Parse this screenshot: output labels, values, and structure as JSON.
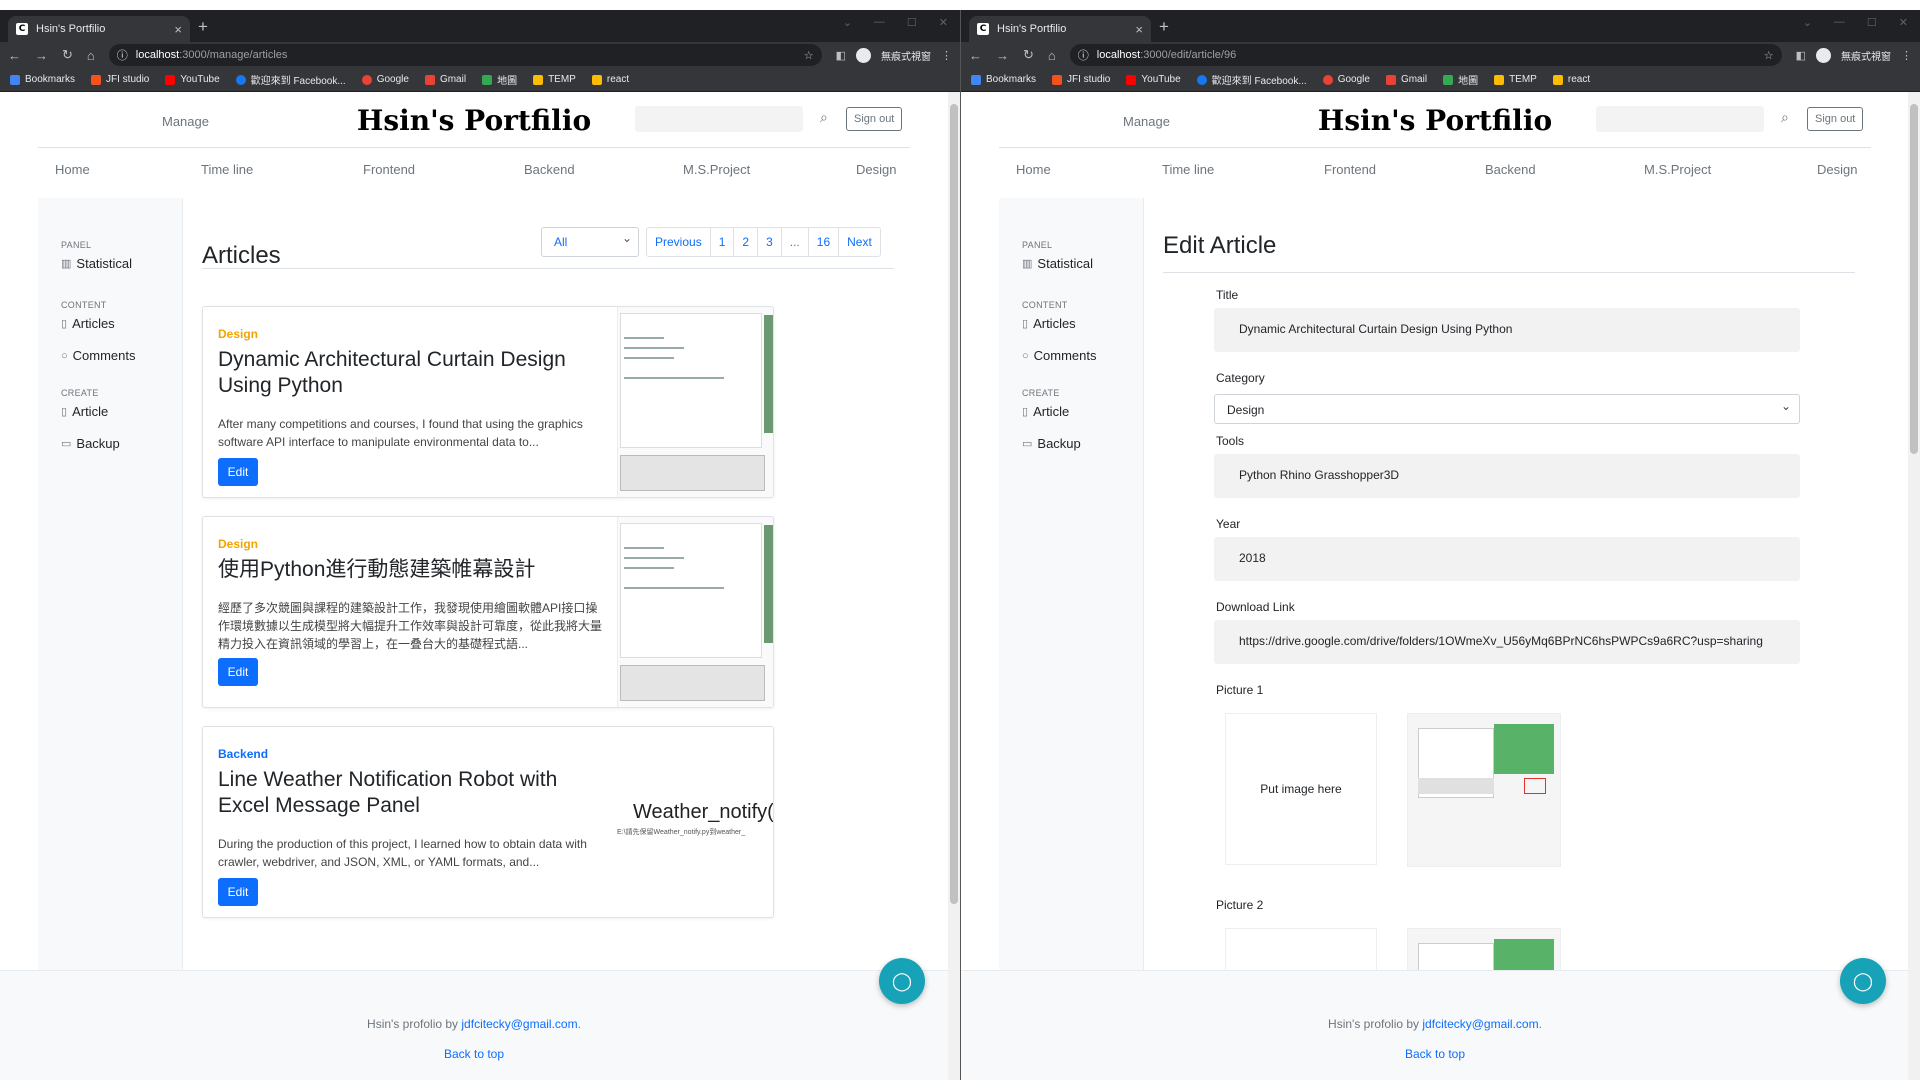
{
  "browser": {
    "tab_title": "Hsin's Portfilio",
    "tab_close": "×",
    "new_tab": "+",
    "profile_label": "無痕式視窗",
    "left_url_host": "localhost",
    "left_url_path": ":3000/manage/articles",
    "right_url_host": "localhost",
    "right_url_path": ":3000/edit/article/96",
    "bookmarks": [
      "Bookmarks",
      "JFI studio",
      "YouTube",
      "歡迎來到 Facebook...",
      "Google",
      "Gmail",
      "地圖",
      "TEMP",
      "react"
    ],
    "bookmark_colors": [
      "#4285f4",
      "#f4511e",
      "#ff0000",
      "#1877f2",
      "#ea4335",
      "#ea4335",
      "#34a853",
      "#fbbc04",
      "#fbbc04"
    ]
  },
  "site": {
    "manage": "Manage",
    "brand": "Hsin's Portfilio",
    "sign_out": "Sign out",
    "nav": [
      "Home",
      "Time line",
      "Frontend",
      "Backend",
      "M.S.Project",
      "Design"
    ]
  },
  "sidebar": {
    "panel_head": "PANEL",
    "statistical": "Statistical",
    "content_head": "CONTENT",
    "articles": "Articles",
    "comments": "Comments",
    "create_head": "CREATE",
    "article": "Article",
    "backup": "Backup"
  },
  "articles_page": {
    "title": "Articles",
    "filter": "All",
    "pager": [
      "Previous",
      "1",
      "2",
      "3",
      "...",
      "16",
      "Next"
    ],
    "edit_label": "Edit",
    "cards": [
      {
        "category": "Design",
        "category_color": "#f0a500",
        "title": "Dynamic Architectural Curtain Design Using Python",
        "desc": "After many competitions and courses, I found that using the graphics software API interface to manipulate environmental data to..."
      },
      {
        "category": "Design",
        "category_color": "#f0a500",
        "title": "使用Python進行動態建築帷幕設計",
        "desc": "經歷了多次競圖與課程的建築設計工作，我發現使用繪圖軟體API接口操作環境數據以生成模型將大幅提升工作效率與設計可靠度，從此我將大量精力投入在資訊領域的學習上，在一叠台大的基礎程式語..."
      },
      {
        "category": "Backend",
        "category_color": "#0d6efd",
        "title": "Line Weather Notification Robot with Excel Message Panel",
        "desc": "During the production of this project, I learned how to obtain data with crawler, webdriver, and JSON, XML, or YAML formats, and...",
        "thumb_text": "Weather_notify(",
        "thumb_sub": "E:\\請先保留Weather_notify.py到weather_"
      }
    ]
  },
  "edit_page": {
    "title": "Edit Article",
    "title_label": "Title",
    "title_value": "Dynamic Architectural Curtain Design Using Python",
    "category_label": "Category",
    "category_value": "Design",
    "tools_label": "Tools",
    "tools_value": "Python Rhino Grasshopper3D",
    "year_label": "Year",
    "year_value": "2018",
    "download_label": "Download Link",
    "download_value": "https://drive.google.com/drive/folders/1OWmeXv_U56yMq6BPrNC6hsPWPCs9a6RC?usp=sharing",
    "picture1_label": "Picture 1",
    "dropzone_text": "Put image here",
    "picture2_label": "Picture 2"
  },
  "footer": {
    "credit_prefix": "Hsin's profolio by ",
    "email": "jdfcitecky@gmail.com",
    "credit_suffix": ".",
    "back_to_top": "Back to top"
  }
}
